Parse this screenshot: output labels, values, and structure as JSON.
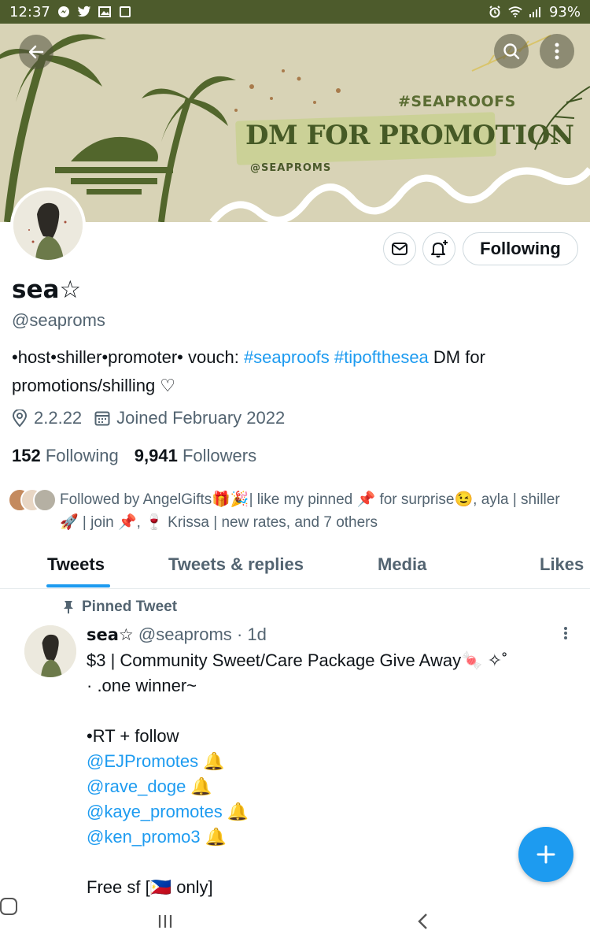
{
  "status_bar": {
    "time": "12:37",
    "battery": "93%",
    "left_icons": [
      "messenger-icon",
      "twitter-icon",
      "gallery-icon",
      "app-icon"
    ],
    "right_icons": [
      "alarm-icon",
      "wifi-icon",
      "signal-icon"
    ]
  },
  "banner": {
    "hashtag": "#SEAPROOFS",
    "title": "DM FOR PROMOTION",
    "handle": "@SEAPROMS",
    "colors": {
      "background": "#d8d3b6",
      "palm": "#52662c"
    }
  },
  "profile": {
    "display_name": "sea☆",
    "username": "@seaproms",
    "bio_prefix": "•host•shiller•promoter• vouch: ",
    "bio_hashtag_1": "#seaproofs",
    "bio_hashtag_2": "#tipofthesea",
    "bio_suffix": " DM for promotions/shilling ♡",
    "location": "2.2.22",
    "joined": "Joined February 2022",
    "following_count": "152",
    "following_label": "Following",
    "followers_count": "9,941",
    "followers_label": "Followers",
    "follow_button_label": "Following",
    "followed_by": "Followed by AngelGifts🎁🎉| like my pinned 📌 for surprise😉, ayla | shiller 🚀 | join 📌, 🍷 Krissa | new rates, and 7 others"
  },
  "tabs": [
    "Tweets",
    "Tweets & replies",
    "Media",
    "Likes"
  ],
  "active_tab": "Tweets",
  "tweet": {
    "pinned_label": "Pinned Tweet",
    "author_name": "sea☆",
    "author_handle": "@seaproms",
    "time": "· 1d",
    "line1": "$3 | Community Sweet/Care Package Give Away🍬 ✧˚",
    "line2": "· .one winner~",
    "line3": "•RT + follow",
    "mentions": [
      "@EJPromotes",
      "@rave_doge",
      "@kaye_promotes",
      "@ken_promo3"
    ],
    "mention_suffix": " 🔔",
    "line4": "Free sf [🇵🇭 only]"
  },
  "accent_color": "#1d9bf0"
}
